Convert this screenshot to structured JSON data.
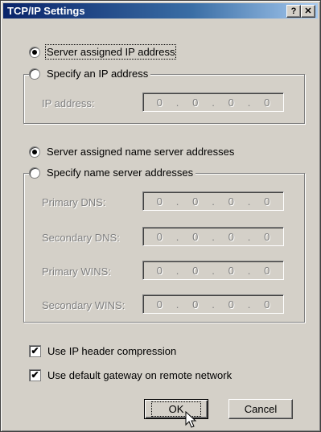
{
  "window": {
    "title": "TCP/IP Settings",
    "help_glyph": "?",
    "close_glyph": "✕"
  },
  "ip_section": {
    "server_assigned_label": "Server assigned IP address",
    "specify_label": "Specify an IP address",
    "selected": "server_assigned",
    "fields": [
      {
        "label": "IP address:",
        "octets": [
          "0",
          "0",
          "0",
          "0"
        ]
      }
    ]
  },
  "dns_section": {
    "server_assigned_label": "Server assigned name server addresses",
    "specify_label": "Specify name server addresses",
    "selected": "server_assigned",
    "fields": [
      {
        "label": "Primary DNS:",
        "octets": [
          "0",
          "0",
          "0",
          "0"
        ]
      },
      {
        "label": "Secondary DNS:",
        "octets": [
          "0",
          "0",
          "0",
          "0"
        ]
      },
      {
        "label": "Primary WINS:",
        "octets": [
          "0",
          "0",
          "0",
          "0"
        ]
      },
      {
        "label": "Secondary WINS:",
        "octets": [
          "0",
          "0",
          "0",
          "0"
        ]
      }
    ]
  },
  "options": {
    "compression_label": "Use IP header compression",
    "compression_checked": true,
    "gateway_label": "Use default gateway on remote network",
    "gateway_checked": true
  },
  "buttons": {
    "ok": "OK",
    "cancel": "Cancel"
  },
  "colors": {
    "dialog_bg": "#d4d0c8",
    "title_start": "#0a246a",
    "title_end": "#a6caf0",
    "disabled_text": "#808080"
  },
  "icons": {
    "cursor": "arrow-pointer-icon"
  }
}
